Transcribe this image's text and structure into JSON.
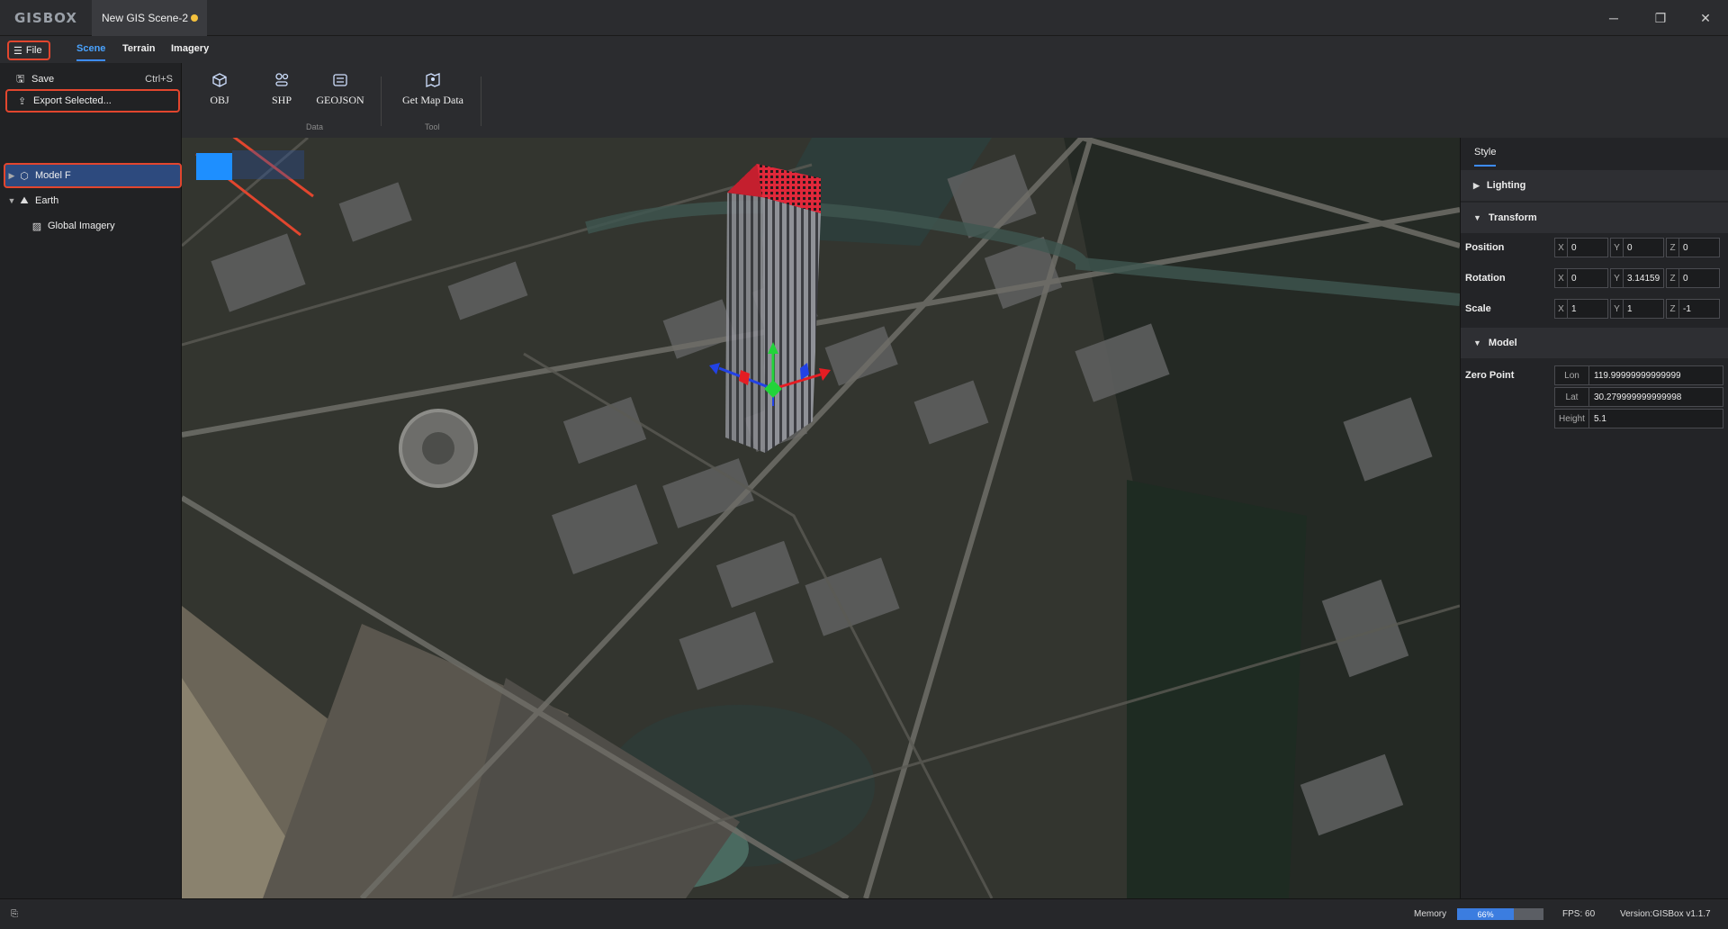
{
  "app": {
    "logo": "GISBOX",
    "tab_title": "New GIS Scene-2"
  },
  "window_controls": {
    "minimize": "─",
    "restore": "❐",
    "close": "✕"
  },
  "menubar": {
    "file": "File",
    "tabs": [
      "Scene",
      "Terrain",
      "Imagery"
    ],
    "active_tab": "Scene"
  },
  "file_menu": {
    "items": [
      {
        "label": "Save",
        "shortcut": "Ctrl+S",
        "icon": "save-icon"
      },
      {
        "label": "Export Selected...",
        "shortcut": "",
        "icon": "export-icon"
      }
    ]
  },
  "scene_tree": {
    "items": [
      {
        "label": "Model F",
        "icon": "cube-icon",
        "selected": true
      },
      {
        "label": "Earth",
        "icon": "earth-icon",
        "selected": false
      },
      {
        "label": "Global Imagery",
        "icon": "imagery-icon",
        "selected": false
      }
    ]
  },
  "ribbon": {
    "buttons": [
      {
        "label": "OBJ",
        "icon": "cube-icon"
      },
      {
        "label": "SHP",
        "icon": "shapes-icon"
      },
      {
        "label": "GEOJSON",
        "icon": "geojson-icon"
      },
      {
        "label": "Get Map Data",
        "icon": "map-pin-icon"
      }
    ],
    "groups": [
      "Data",
      "Tool"
    ]
  },
  "properties": {
    "tab": "Style",
    "sections": {
      "lighting": "Lighting",
      "transform": "Transform",
      "model": "Model"
    },
    "position": {
      "label": "Position",
      "x": "0",
      "y": "0",
      "z": "0"
    },
    "rotation": {
      "label": "Rotation",
      "x": "0",
      "y": "3.14159",
      "z": "0"
    },
    "scale": {
      "label": "Scale",
      "x": "1",
      "y": "1",
      "z": "-1"
    },
    "axes": {
      "x": "X",
      "y": "Y",
      "z": "Z"
    },
    "zero_point": {
      "label": "Zero Point",
      "lon_label": "Lon",
      "lon": "119.99999999999999",
      "lat_label": "Lat",
      "lat": "30.279999999999998",
      "height_label": "Height",
      "height": "5.1"
    }
  },
  "status": {
    "memory_label": "Memory",
    "memory_percent": 66,
    "memory_text": "66%",
    "fps": "FPS: 60",
    "version": "Version:GISBox v1.1.7"
  },
  "colors": {
    "accent": "#3d8cff",
    "highlight": "#e2462e",
    "selected_bg": "#2d4a7e",
    "unsaved_dot": "#f4c13d"
  }
}
